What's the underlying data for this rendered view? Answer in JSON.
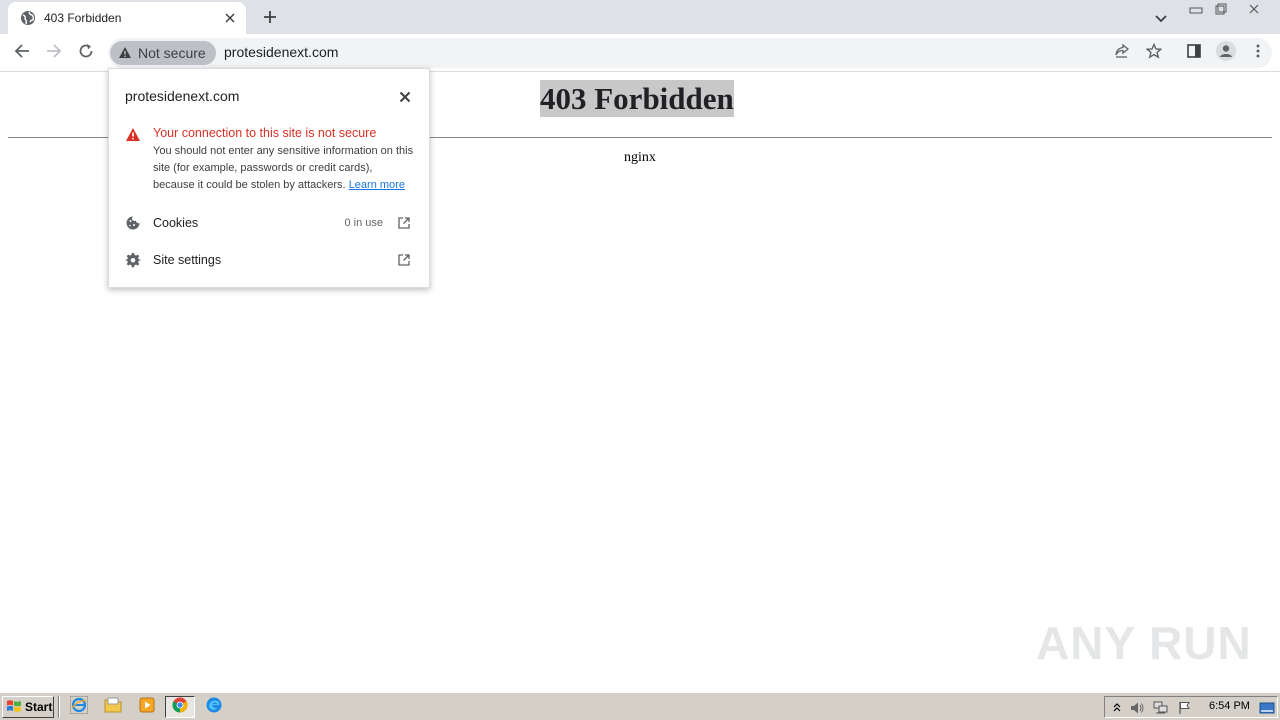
{
  "browser": {
    "tab": {
      "title": "403 Forbidden",
      "favicon": "globe-icon"
    },
    "toolbar": {
      "security_chip": "Not secure",
      "url": "protesidenext.com"
    }
  },
  "page": {
    "heading": "403 Forbidden",
    "server": "nginx"
  },
  "site_info_popup": {
    "host": "protesidenext.com",
    "warning_title": "Your connection to this site is not secure",
    "warning_body": "You should not enter any sensitive information on this site (for example, passwords or credit cards), because it could be stolen by attackers.",
    "learn_more": "Learn more",
    "rows": [
      {
        "label": "Cookies",
        "value": "0 in use",
        "icon": "cookie-icon"
      },
      {
        "label": "Site settings",
        "value": "",
        "icon": "gear-icon"
      }
    ]
  },
  "watermark": {
    "text": "ANY RUN"
  },
  "taskbar": {
    "start_label": "Start",
    "apps": [
      "ie-icon",
      "folder-icon",
      "media-player-icon",
      "chrome-icon",
      "edge-icon"
    ],
    "clock": "6:54 PM"
  },
  "colors": {
    "warning_red": "#d93025",
    "link_blue": "#1a73e8",
    "tabstrip_bg": "#dee1e6",
    "taskbar_bg": "#d4d0c8"
  }
}
